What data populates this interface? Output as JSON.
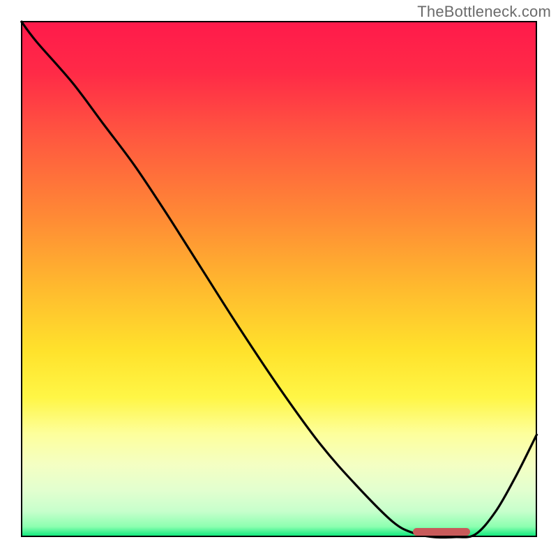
{
  "watermark": "TheBottleneck.com",
  "colors": {
    "curve": "#000000",
    "marker": "#c85a5a",
    "border": "#000000",
    "gradient_top": "#ff1a4b",
    "gradient_bottom": "#00e676"
  },
  "chart_data": {
    "type": "line",
    "title": "",
    "xlabel": "",
    "ylabel": "",
    "xlim": [
      0,
      100
    ],
    "ylim": [
      0,
      100
    ],
    "x": [
      0,
      3,
      10,
      16,
      22,
      28,
      35,
      42,
      50,
      58,
      65,
      72,
      76,
      80,
      84,
      88,
      92,
      96,
      100
    ],
    "values": [
      100,
      96,
      88,
      80,
      72,
      63,
      52,
      41,
      29,
      18,
      10,
      3,
      0.8,
      0,
      0,
      0.5,
      5,
      12,
      20
    ],
    "marker_x_range": [
      76,
      87
    ],
    "annotations": []
  }
}
